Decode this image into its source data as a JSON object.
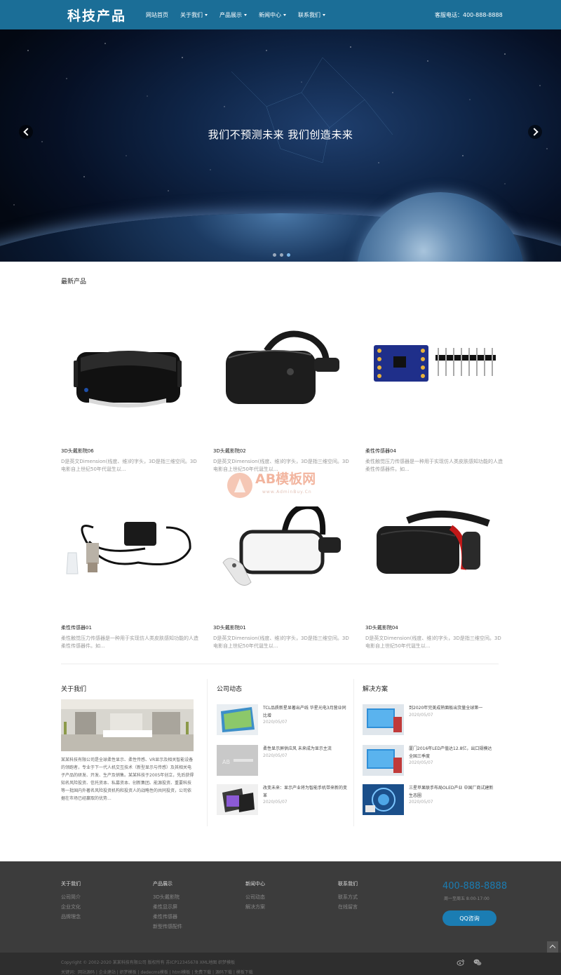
{
  "header": {
    "logo": "科技产品",
    "nav": [
      {
        "label": "网站首页",
        "has_dropdown": false
      },
      {
        "label": "关于我们",
        "has_dropdown": true
      },
      {
        "label": "产品展示",
        "has_dropdown": true
      },
      {
        "label": "新闻中心",
        "has_dropdown": true
      },
      {
        "label": "联系我们",
        "has_dropdown": true
      }
    ],
    "hotline": "客服电话：400-888-8888",
    "bg_color": "#1b6e97"
  },
  "banner": {
    "title": "我们不预测未来  我们创造未来",
    "slides": 3,
    "active_slide": 3
  },
  "latest": {
    "title": "最新产品",
    "products": [
      {
        "name": "3D头戴影院06",
        "desc": "D是英文Dimension(线度、维)的字头，3D是指三维空间。3D电影自上世纪50年代诞生以..."
      },
      {
        "name": "3D头戴影院02",
        "desc": "D是英文Dimension(线度、维)的字头，3D是指三维空间。3D电影自上世纪50年代诞生以..."
      },
      {
        "name": "柔性传感器04",
        "desc": "柔性触觉压力传感器是一种用于实现仿人类皮肤感知功能的人造柔性传感器件。如..."
      },
      {
        "name": "柔性传感器01",
        "desc": "柔性触觉压力传感器是一种用于实现仿人类皮肤感知功能的人造柔性传感器件。如..."
      },
      {
        "name": "3D头戴影院01",
        "desc": "D是英文Dimension(线度、维)的字头，3D是指三维空间。3D电影自上世纪50年代诞生以..."
      },
      {
        "name": "3D头戴影院04",
        "desc": "D是英文Dimension(线度、维)的字头，3D是指三维空间。3D电影自上世纪50年代诞生以..."
      }
    ],
    "watermark": "AB模板网",
    "watermark_sub": "www.AdminBuy.Cn"
  },
  "about": {
    "title": "关于我们",
    "text": "某某科技有限公司是全球柔性显示、柔性传感、VR显示及相关智能设备的领跑者，专业于下一代人机交互技术（新型显示与传感）及其相关电子产品的研发、开发、生产及销售。某某科技于2005年创立，先后获得知名风险投资、信托资本、私募资本、创新集团、能源投资、重要科技等一批国内外著名风险投资机构和投资人的战略性的共同投资，公司依据在市场已经赢取的优势..."
  },
  "news": {
    "title": "公司动态",
    "items": [
      {
        "title": "TCL品质新星显著出产线 华星光电3月营业同比增",
        "date": "2020/05/07"
      },
      {
        "title": "柔性显示屏供应风 未来成为显示主流",
        "date": "2020/05/07"
      },
      {
        "title": "改变未来：显示产业将为智能手机带来新的变革",
        "date": "2020/05/07"
      }
    ]
  },
  "solutions": {
    "title": "解决方案",
    "items": [
      {
        "title": "到2020年完美成熟面板出货量全球第一",
        "date": "2020/05/07"
      },
      {
        "title": "厦门2016年LED产值达12.8亿，出口规模达全国三季度",
        "date": "2020/05/07"
      },
      {
        "title": "三星苹果联手布局OLED产业 中国厂商试建新生态圈",
        "date": "2020/05/07"
      }
    ]
  },
  "footer": {
    "columns": [
      {
        "title": "关于我们",
        "links": [
          "公司简介",
          "企业文化",
          "品牌理念"
        ]
      },
      {
        "title": "产品展示",
        "links": [
          "3D头戴影院",
          "柔性显示屏",
          "柔性传感器",
          "新型传感配件"
        ]
      },
      {
        "title": "新闻中心",
        "links": [
          "公司动态",
          "解决方案"
        ]
      },
      {
        "title": "联系我们",
        "links": [
          "联系方式",
          "在线留言"
        ]
      }
    ],
    "phone": "400-888-8888",
    "hours": "周一至周五 8:00-17:00",
    "qq_button": "QQ咨询",
    "copyright": "Copyright © 2002-2020 某某科技有限公司 版权所有 苏ICP12345678 XML地图 织梦模板",
    "sub_copyright": "关键词：网站源码 | 企业建站 | 织梦模板 | dedecms模板 | html模板 | 免费下载 | 源码下载 | 模板下载",
    "accent_color": "#1b7db3"
  }
}
